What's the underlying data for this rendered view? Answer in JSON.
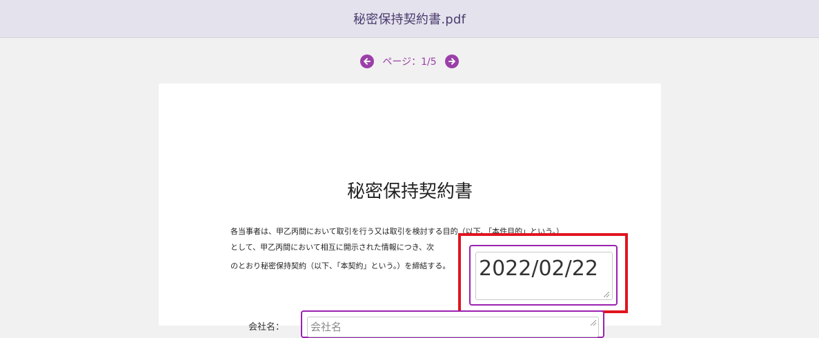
{
  "window": {
    "title": "秘密保持契約書.pdf"
  },
  "pager": {
    "label": "ページ：1/5"
  },
  "icons": {
    "prev": "arrow-left-circle",
    "next": "arrow-right-circle"
  },
  "colors": {
    "accent": "#9b40a8",
    "highlight": "#e0141e",
    "field_border": "#9b1fb0"
  },
  "document": {
    "title": "秘密保持契約書",
    "paragraph_lines": [
      "各当事者は、甲乙丙間において取引を行う又は取引を検討する目的（以下、「本件目的」という。）",
      "として、甲乙丙間において相互に開示された情報につき、次",
      "のとおり秘密保持契約（以下、「本契約」という。）を締結する。"
    ]
  },
  "fields": {
    "date": {
      "value": "2022/02/22"
    },
    "company": {
      "label": "会社名：",
      "placeholder": "会社名"
    }
  }
}
